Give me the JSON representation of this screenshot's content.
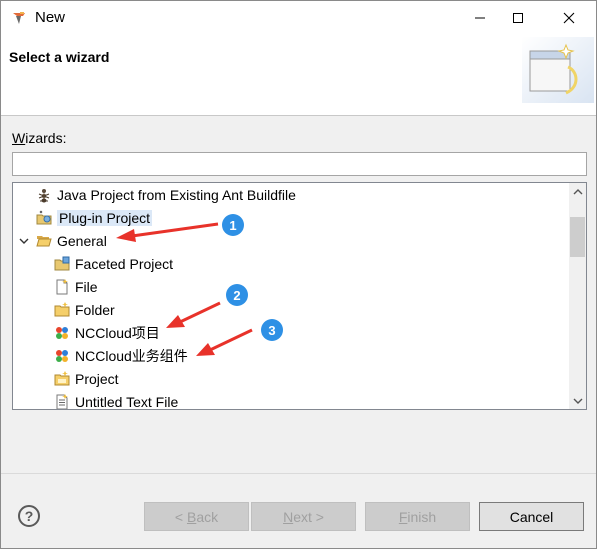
{
  "window": {
    "title": "New"
  },
  "header": {
    "title": "Select a wizard"
  },
  "wizards": {
    "label_prefix": "W",
    "label_rest": "izards:",
    "filter_value": ""
  },
  "tree": {
    "items": [
      {
        "label": "Java Project from Existing Ant Buildfile",
        "icon": "ant-icon"
      },
      {
        "label": "Plug-in Project",
        "icon": "plugin-project-icon"
      },
      {
        "label": "General",
        "icon": "folder-open-icon"
      },
      {
        "label": "Faceted Project",
        "icon": "faceted-project-icon"
      },
      {
        "label": "File",
        "icon": "file-icon"
      },
      {
        "label": "Folder",
        "icon": "folder-icon"
      },
      {
        "label": "NCCloud项目",
        "icon": "nccloud-icon"
      },
      {
        "label": "NCCloud业务组件",
        "icon": "nccloud-icon"
      },
      {
        "label": "Project",
        "icon": "project-icon"
      },
      {
        "label": "Untitled Text File",
        "icon": "text-file-icon"
      }
    ]
  },
  "annotations": [
    "1",
    "2",
    "3"
  ],
  "buttons": {
    "back_prefix": "< ",
    "back_u": "B",
    "back_rest": "ack",
    "next_u": "N",
    "next_rest": "ext >",
    "finish_u": "F",
    "finish_rest": "inish",
    "cancel": "Cancel",
    "help": "?"
  },
  "colors": {
    "annotation_blue": "#2e90e5",
    "arrow_red": "#e8322a",
    "selection": "#dbe8f7"
  }
}
